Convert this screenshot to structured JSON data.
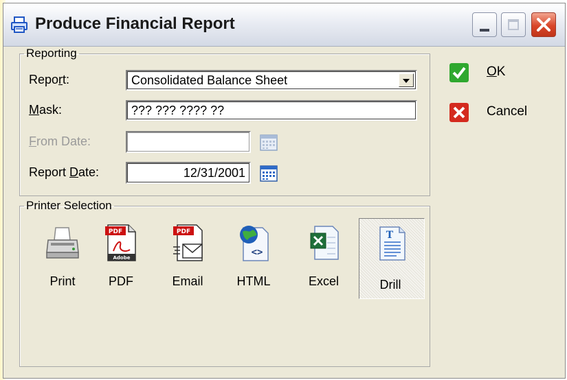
{
  "window": {
    "title": "Produce Financial Report"
  },
  "reporting": {
    "legend": "Reporting",
    "report_label_pre": "Repo",
    "report_label_u": "r",
    "report_label_post": "t:",
    "report_value": "Consolidated Balance Sheet",
    "mask_label_u": "M",
    "mask_label_post": "ask:",
    "mask_value": "??? ??? ???? ??",
    "from_date_label_u": "F",
    "from_date_label_post": "rom Date:",
    "from_date_value": "",
    "report_date_label_pre": "Report ",
    "report_date_label_u": "D",
    "report_date_label_post": "ate:",
    "report_date_value": "12/31/2001"
  },
  "printer_selection": {
    "legend": "Printer Selection",
    "options": [
      {
        "label": "Print",
        "icon": "printer-icon",
        "selected": false
      },
      {
        "label": "PDF",
        "icon": "pdf-icon",
        "selected": false
      },
      {
        "label": "Email",
        "icon": "email-pdf-icon",
        "selected": false
      },
      {
        "label": "HTML",
        "icon": "html-icon",
        "selected": false
      },
      {
        "label": "Excel",
        "icon": "excel-icon",
        "selected": false
      },
      {
        "label": "Drill",
        "icon": "drill-document-icon",
        "selected": true
      }
    ]
  },
  "actions": {
    "ok_u": "O",
    "ok_post": "K",
    "cancel": "Cancel"
  },
  "colors": {
    "dialog_bg": "#ece9d8",
    "ok_green": "#2fa82f",
    "cancel_red": "#d42a1e",
    "close_red": "#d9462a"
  }
}
